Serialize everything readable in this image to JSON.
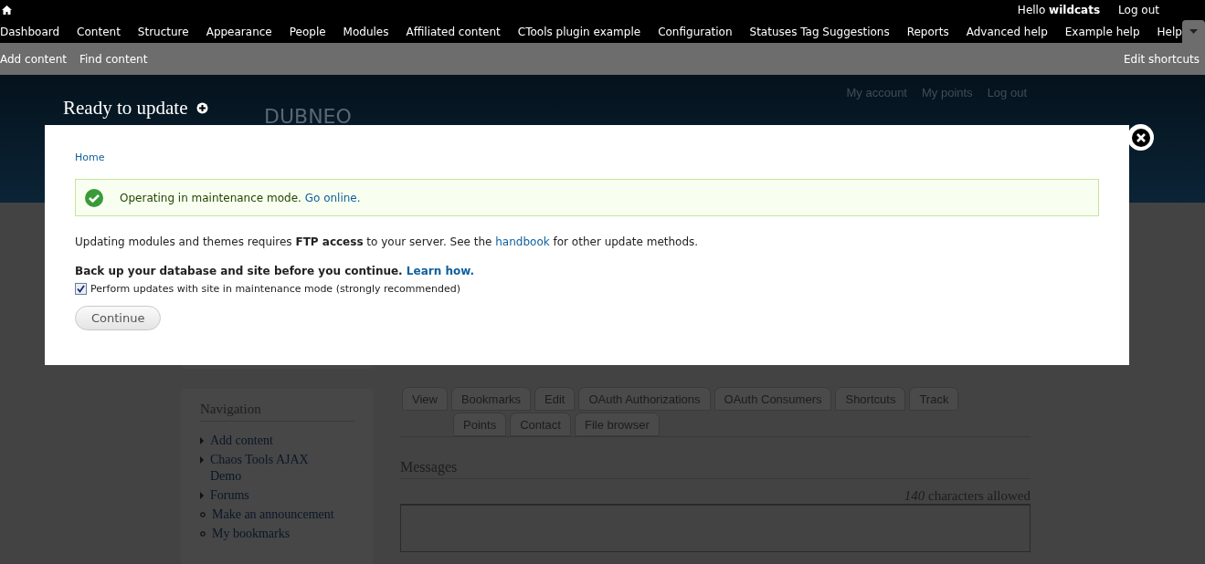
{
  "toolbar": {
    "greeting": "Hello **wildcats**",
    "logout": "Log out",
    "menu": [
      "Dashboard",
      "Content",
      "Structure",
      "Appearance",
      "People",
      "Modules",
      "Affiliated content",
      "CTools plugin example",
      "Configuration",
      "Statuses Tag Suggestions",
      "Reports",
      "Advanced help",
      "Example help",
      "Help"
    ]
  },
  "shortcuts": {
    "items": [
      "Add content",
      "Find content"
    ],
    "edit": "Edit shortcuts"
  },
  "header": {
    "logo": "DUBNEO",
    "links": [
      "My account",
      "My points",
      "Log out"
    ]
  },
  "overlay": {
    "title": "Ready to update",
    "breadcrumb": "Home",
    "status": {
      "text": "Operating in maintenance mode.",
      "link": "Go online."
    },
    "intro": {
      "before": "Updating modules and themes requires **FTP access** to your server. See the",
      "link": "handbook",
      "after": "for other update methods."
    },
    "warning": {
      "text": "Back up your database and site before you continue.",
      "link": "Learn how."
    },
    "checkbox": {
      "label": "Perform updates with site in maintenance mode (strongly recommended)",
      "checked": true
    },
    "button": "Continue"
  },
  "sidebar": {
    "title": "Navigation",
    "items": [
      {
        "label": "Add content",
        "kind": "collapsed"
      },
      {
        "label": "Chaos Tools AJAX Demo",
        "kind": "collapsed"
      },
      {
        "label": "Forums",
        "kind": "collapsed"
      },
      {
        "label": "Make an announcement",
        "kind": "leaf"
      },
      {
        "label": "My bookmarks",
        "kind": "leaf"
      }
    ]
  },
  "tabs": {
    "upper": [
      "View",
      "Bookmarks",
      "Edit",
      "OAuth Authorizations",
      "OAuth Consumers",
      "Shortcuts",
      "Track"
    ],
    "lower": [
      "Points",
      "Contact",
      "File browser"
    ]
  },
  "messages": {
    "title": "Messages",
    "count": "140",
    "count_label": "characters allowed"
  }
}
